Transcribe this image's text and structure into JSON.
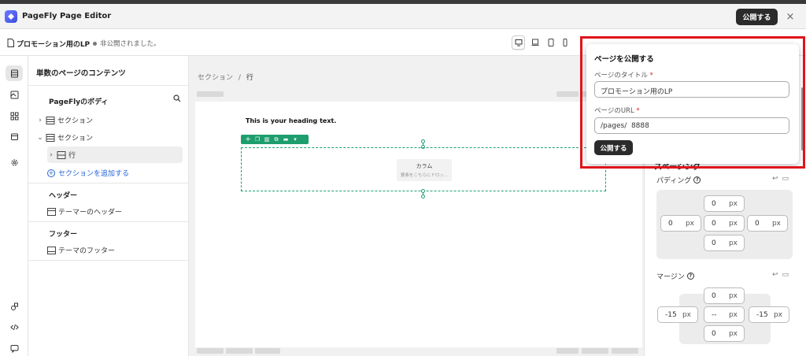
{
  "app": {
    "title": "PageFly Page Editor",
    "publish_label": "公開する",
    "close_symbol": "×"
  },
  "page_info": {
    "name": "プロモーション用のLP",
    "status": "非公開されました。"
  },
  "left_panel": {
    "header": "単数のページのコンテンツ",
    "body_title": "PageFlyのボディ",
    "tree": [
      {
        "chevron": "›",
        "label": "セクション"
      },
      {
        "chevron": "⌄",
        "label": "セクション"
      },
      {
        "chevron": "›",
        "label": "行"
      }
    ],
    "add_section": "セクションを追加する",
    "header_group": "ヘッダー",
    "header_item": "テーマーのヘッダー",
    "footer_group": "フッター",
    "footer_item": "テーマのフッター"
  },
  "canvas": {
    "breadcrumb_section": "セクション",
    "breadcrumb_sep": "/",
    "breadcrumb_row": "行",
    "heading_text": "This is your heading text.",
    "column_label": "カラム",
    "column_hint": "要素をこちらにドロッ..."
  },
  "right_panel": {
    "spacing_title": "スペーシング",
    "padding_label": "パディング",
    "margin_label": "マージン",
    "help_symbol": "?",
    "unit": "px",
    "padding": {
      "top": "0",
      "left": "0",
      "center": "0",
      "right": "0",
      "bottom": "0"
    },
    "margin": {
      "top": "0",
      "left": "-15",
      "center": "--",
      "right": "-15",
      "bottom": "0"
    }
  },
  "publish_popup": {
    "title": "ページを公開する",
    "title_label": "ページのタイトル",
    "title_value": "プロモーション用のLP",
    "url_label": "ページのURL",
    "url_value": "/pages/  8888",
    "required_mark": "*",
    "button": "公開する"
  },
  "colors": {
    "highlight": "#e0141b",
    "accent_green": "#1e9e6e",
    "link_blue": "#2463d6",
    "dark_button": "#2b2b2b"
  }
}
